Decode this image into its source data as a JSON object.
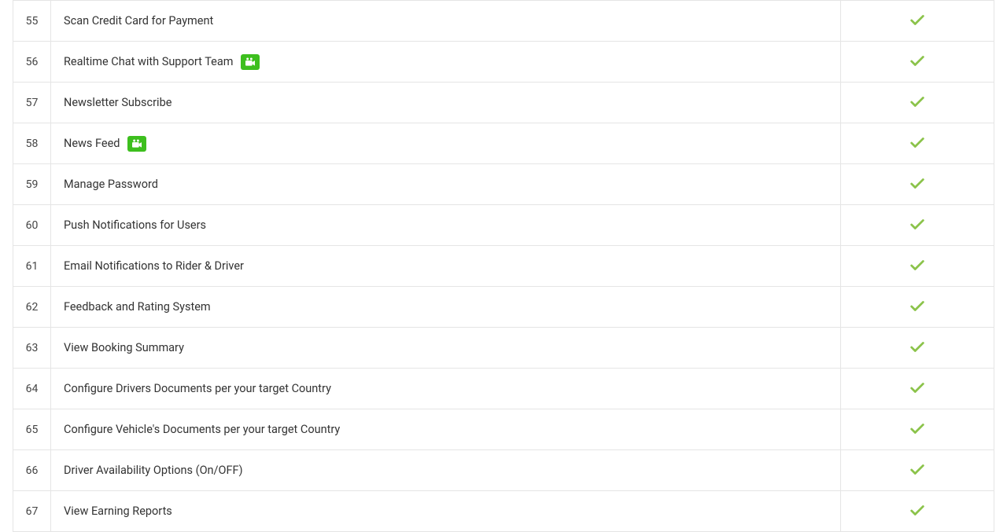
{
  "colors": {
    "check": "#8bc34a",
    "videoBg": "#3dbf1e",
    "border": "#e5e5e5"
  },
  "rows": [
    {
      "num": "55",
      "feature": "Scan Credit Card for Payment",
      "hasVideo": false,
      "checked": true
    },
    {
      "num": "56",
      "feature": "Realtime Chat with Support Team",
      "hasVideo": true,
      "checked": true
    },
    {
      "num": "57",
      "feature": "Newsletter Subscribe",
      "hasVideo": false,
      "checked": true
    },
    {
      "num": "58",
      "feature": "News Feed",
      "hasVideo": true,
      "checked": true
    },
    {
      "num": "59",
      "feature": "Manage Password",
      "hasVideo": false,
      "checked": true
    },
    {
      "num": "60",
      "feature": "Push Notifications for Users",
      "hasVideo": false,
      "checked": true
    },
    {
      "num": "61",
      "feature": "Email Notifications to Rider & Driver",
      "hasVideo": false,
      "checked": true
    },
    {
      "num": "62",
      "feature": "Feedback and Rating System",
      "hasVideo": false,
      "checked": true
    },
    {
      "num": "63",
      "feature": "View Booking Summary",
      "hasVideo": false,
      "checked": true
    },
    {
      "num": "64",
      "feature": "Configure Drivers Documents per your target Country",
      "hasVideo": false,
      "checked": true
    },
    {
      "num": "65",
      "feature": "Configure Vehicle's Documents per your target Country",
      "hasVideo": false,
      "checked": true
    },
    {
      "num": "66",
      "feature": "Driver Availability Options (On/OFF)",
      "hasVideo": false,
      "checked": true
    },
    {
      "num": "67",
      "feature": "View Earning Reports",
      "hasVideo": false,
      "checked": true
    }
  ]
}
